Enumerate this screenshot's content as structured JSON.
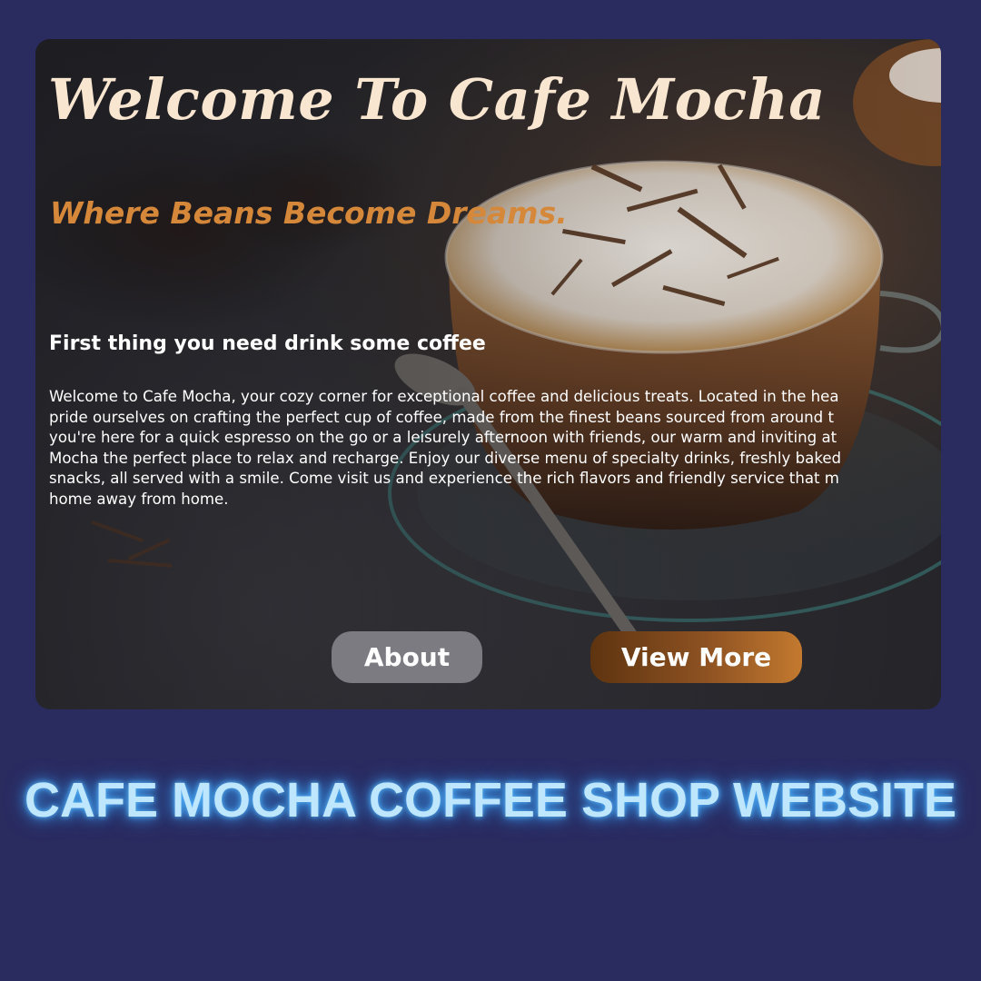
{
  "hero": {
    "title": "Welcome To Cafe Mocha",
    "tagline": "Where Beans Become Dreams.",
    "heading": "First thing you need drink some coffee",
    "body_lines": [
      "Welcome to Cafe Mocha, your cozy corner for exceptional coffee and delicious treats. Located in the hea",
      "pride ourselves on crafting the perfect cup of coffee, made from the finest beans sourced from around t",
      "you're here for a quick espresso on the go or a leisurely afternoon with friends, our warm and inviting at",
      "Mocha the perfect place to relax and recharge. Enjoy our diverse menu of specialty drinks, freshly baked",
      "snacks, all served with a smile. Come visit us and experience the rich flavors and friendly service that m",
      "home away from home."
    ],
    "about_label": "About",
    "view_more_label": "View More"
  },
  "banner": {
    "title": "CAFE MOCHA COFFEE SHOP WEBSITE"
  },
  "colors": {
    "page_background": "#2a2b5f",
    "title": "#f8e6d0",
    "tagline": "#d6883a",
    "banner_text": "#bfe6ff",
    "banner_glow": "#3d9ef0"
  }
}
